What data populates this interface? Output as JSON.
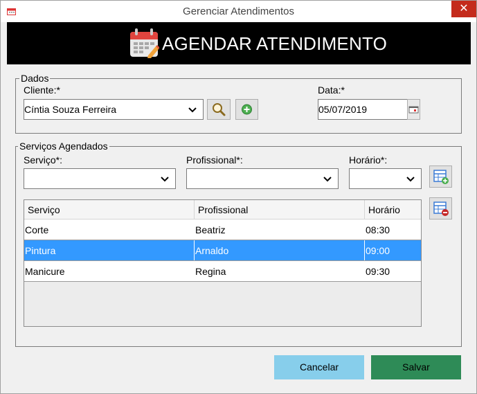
{
  "window": {
    "title": "Gerenciar Atendimentos",
    "close_glyph": "✕"
  },
  "banner": {
    "title": "AGENDAR ATENDIMENTO",
    "icon": "calendar-icon"
  },
  "dados": {
    "legend": "Dados",
    "cliente_label": "Cliente:*",
    "cliente_value": "Cíntia Souza Ferreira",
    "data_label": "Data:*",
    "data_value": "05/07/2019"
  },
  "servicos": {
    "legend": "Serviços Agendados",
    "servico_label": "Serviço*:",
    "profissional_label": "Profissional*:",
    "horario_label": "Horário*:",
    "columns": [
      "Serviço",
      "Profissional",
      "Horário"
    ],
    "rows": [
      {
        "servico": "Corte",
        "profissional": "Beatriz",
        "horario": "08:30",
        "selected": false
      },
      {
        "servico": "Pintura",
        "profissional": "Arnaldo",
        "horario": "09:00",
        "selected": true
      },
      {
        "servico": "Manicure",
        "profissional": "Regina",
        "horario": "09:30",
        "selected": false
      }
    ]
  },
  "buttons": {
    "cancel_label": "Cancelar",
    "save_label": "Salvar"
  },
  "colors": {
    "cancel_bg": "#87ceeb",
    "save_bg": "#2e8b57",
    "selection": "#3399ff",
    "banner_bg": "#000000",
    "close_bg": "#c42b1c"
  }
}
